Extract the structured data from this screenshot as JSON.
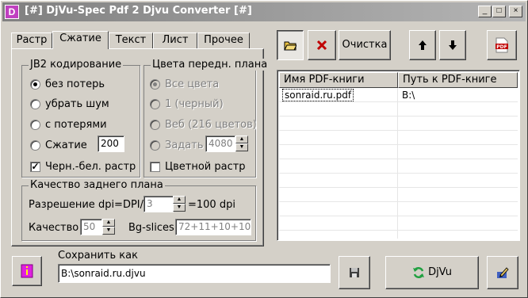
{
  "window": {
    "title": "[#] DjVu-Spec Pdf 2 Djvu Converter [#]",
    "icon_letter": "D",
    "controls": [
      "_",
      "□",
      "×"
    ]
  },
  "tabs": [
    {
      "label": "Растр",
      "active": false
    },
    {
      "label": "Сжатие",
      "active": true
    },
    {
      "label": "Текст",
      "active": false
    },
    {
      "label": "Лист",
      "active": false
    },
    {
      "label": "Прочее",
      "active": false
    }
  ],
  "jb2": {
    "title": "JB2 кодирование",
    "options": [
      "без потерь",
      "убрать шум",
      "с потерями",
      "Сжатие"
    ],
    "selected": 0,
    "compression_value": "200",
    "bw_raster_label": "Черн.-бел. растр",
    "bw_raster_checked": true
  },
  "fg_colors": {
    "title": "Цвета передн. плана",
    "options": [
      "Все цвета",
      "1 (черный)",
      "Веб (216 цветов)",
      "Задать"
    ],
    "selected": 0,
    "custom_value": "4080",
    "color_raster_label": "Цветной растр",
    "color_raster_checked": false
  },
  "bg_quality": {
    "title": "Качество заднего плана",
    "resolution_label": "Разрешение dpi=DPI/",
    "resolution_value": "3",
    "resolution_result": "=100 dpi",
    "quality_label": "Качество",
    "quality_value": "50",
    "bg_slices_label": "Bg-slices",
    "bg_slices_value": "72+11+10+10"
  },
  "toolbar": {
    "clear_label": "Очистка"
  },
  "file_list": {
    "columns": [
      "Имя PDF-книги",
      "Путь к PDF-книге"
    ],
    "rows": [
      {
        "name": "sonraid.ru.pdf",
        "path": "B:\\"
      }
    ]
  },
  "footer": {
    "save_as_label": "Сохранить как",
    "save_as_value": "B:\\sonraid.ru.djvu",
    "convert_label": "DjVu"
  },
  "colors": {
    "accent_icon": "#c040c0",
    "delete_red": "#c00000",
    "folder_yellow": "#e8c040",
    "refresh_green": "#20a040"
  }
}
